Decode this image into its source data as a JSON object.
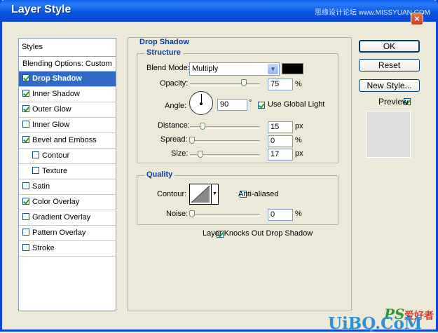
{
  "window": {
    "title": "Layer Style",
    "watermark": "思缘设计论坛 www.MISSYUAN.COM",
    "close": "×"
  },
  "styles_list": {
    "header": "Styles",
    "blending": "Blending Options: Custom",
    "items": [
      {
        "label": "Drop Shadow",
        "checked": true,
        "selected": true
      },
      {
        "label": "Inner Shadow",
        "checked": true
      },
      {
        "label": "Outer Glow",
        "checked": true
      },
      {
        "label": "Inner Glow",
        "checked": false
      },
      {
        "label": "Bevel and Emboss",
        "checked": true
      },
      {
        "label": "Contour",
        "checked": false,
        "indent": true
      },
      {
        "label": "Texture",
        "checked": false,
        "indent": true
      },
      {
        "label": "Satin",
        "checked": false
      },
      {
        "label": "Color Overlay",
        "checked": true
      },
      {
        "label": "Gradient Overlay",
        "checked": false
      },
      {
        "label": "Pattern Overlay",
        "checked": false
      },
      {
        "label": "Stroke",
        "checked": false
      }
    ]
  },
  "drop_shadow": {
    "title": "Drop Shadow",
    "structure": {
      "title": "Structure",
      "blend_mode_label": "Blend Mode:",
      "blend_mode_value": "Multiply",
      "shadow_color": "#000000",
      "opacity_label": "Opacity:",
      "opacity_value": "75",
      "opacity_unit": "%",
      "opacity_level": 75,
      "angle_label": "Angle:",
      "angle_value": "90",
      "angle_unit": "°",
      "global_light_label": "Use Global Light",
      "global_light_checked": true,
      "distance_label": "Distance:",
      "distance_value": "15",
      "distance_unit": "px",
      "spread_label": "Spread:",
      "spread_value": "0",
      "spread_unit": "%",
      "size_label": "Size:",
      "size_value": "17",
      "size_unit": "px"
    },
    "quality": {
      "title": "Quality",
      "contour_label": "Contour:",
      "anti_aliased_label": "Anti-aliased",
      "anti_aliased_checked": false,
      "noise_label": "Noise:",
      "noise_value": "0",
      "noise_unit": "%"
    },
    "knockout_label": "Layer Knocks Out Drop Shadow",
    "knockout_checked": true
  },
  "buttons": {
    "ok": "OK",
    "reset": "Reset",
    "new_style": "New Style...",
    "preview": "Preview",
    "preview_checked": true
  },
  "branding": {
    "ps_logo": "PS",
    "site_cn": "爱好者",
    "site_en": "UiBQ.CoM"
  }
}
